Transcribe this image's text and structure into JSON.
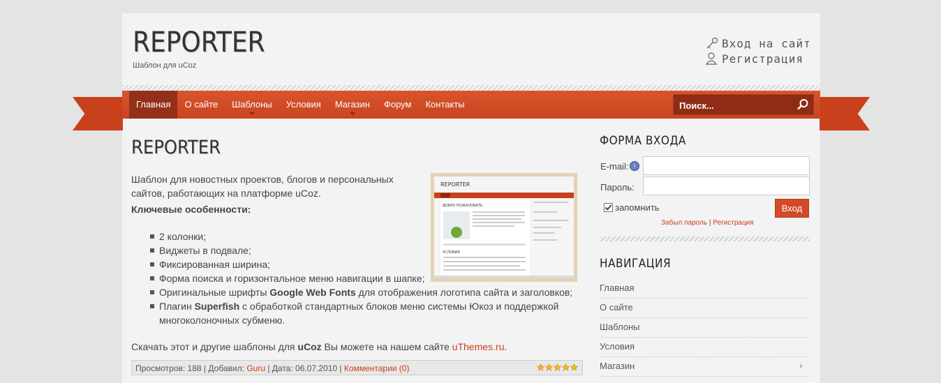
{
  "site": {
    "logo": "REPORTER",
    "tagline": "Шаблон для uCoz"
  },
  "userlinks": {
    "login": "Вход на сайт",
    "register": "Регистрация"
  },
  "menu": {
    "items": [
      {
        "label": "Главная",
        "active": true,
        "has_sub": false
      },
      {
        "label": "О сайте",
        "active": false,
        "has_sub": false
      },
      {
        "label": "Шаблоны",
        "active": false,
        "has_sub": true
      },
      {
        "label": "Условия",
        "active": false,
        "has_sub": false
      },
      {
        "label": "Магазин",
        "active": false,
        "has_sub": true
      },
      {
        "label": "Форум",
        "active": false,
        "has_sub": false
      },
      {
        "label": "Контакты",
        "active": false,
        "has_sub": false
      }
    ],
    "search_placeholder": "Поиск..."
  },
  "post": {
    "title": "REPORTER",
    "intro": "Шаблон для новостных проектов, блогов и персональных сайтов, работающих на платформе uCoz.",
    "features_heading": "Ключевые особенности:",
    "features": [
      "2 колонки;",
      "Виджеты в подвале;",
      "Фиксированная ширина;",
      "Форма поиска и горизонтальное меню навигации в шапке;"
    ],
    "feature_fonts": {
      "before": "Оригинальные шрифты ",
      "bold": "Google Web Fonts",
      "after": " для отображения логотипа сайта и заголовков;"
    },
    "feature_superfish": {
      "before": "Плагин ",
      "bold": "Superfish",
      "after": " с обработкой стандартных блоков меню системы Юкоз и поддержкой многоколоночных субменю."
    },
    "download": {
      "before": "Скачать этот и другие шаблоны для ",
      "bold": "uCoz",
      "middle": " Вы можете на нашем сайте ",
      "link": "uThemes.ru",
      "after": "."
    },
    "meta": {
      "views_label": "Просмотров: ",
      "views": "188",
      "added_label": " | Добавил: ",
      "author": "Guru",
      "date_label": " | Дата: ",
      "date": "06.07.2010",
      "sep": " | ",
      "comments": "Комментарии (0)",
      "rating": 5
    },
    "thumb": {
      "logo": "REPORTER",
      "welcome": "ДОБРО ПОЖАЛОВАТЬ",
      "terms": "УСЛОВИЯ"
    }
  },
  "login_form": {
    "title": "ФОРМА ВХОДА",
    "email_label": "E-mail:",
    "password_label": "Пароль:",
    "remember_label": "запомнить",
    "submit": "Вход",
    "forgot": "Забыл пароль",
    "sep": " | ",
    "register": "Регистрация"
  },
  "navigation": {
    "title": "НАВИГАЦИЯ",
    "items": [
      {
        "label": "Главная",
        "has_sub": false
      },
      {
        "label": "О сайте",
        "has_sub": false
      },
      {
        "label": "Шаблоны",
        "has_sub": false
      },
      {
        "label": "Условия",
        "has_sub": false
      },
      {
        "label": "Магазин",
        "has_sub": true
      }
    ]
  },
  "colors": {
    "accent": "#d24b28",
    "accent_dark": "#94301a",
    "link": "#c9401d",
    "background": "#e4e4e4",
    "page": "#f3f3f3"
  }
}
